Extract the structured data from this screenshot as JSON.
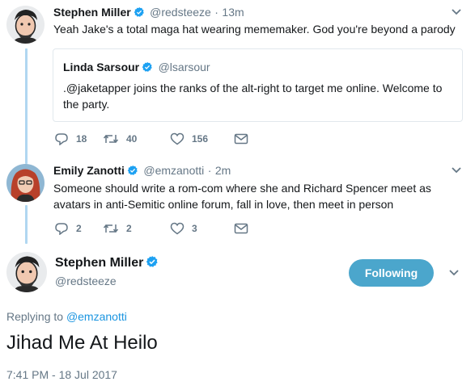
{
  "tweet1": {
    "name": "Stephen Miller",
    "handle": "@redsteeze",
    "separator": "·",
    "time": "13m",
    "text": "Yeah Jake's a total maga hat wearing mememaker. God you're beyond a parody",
    "quote": {
      "name": "Linda Sarsour",
      "handle": "@lsarsour",
      "text": ".@jaketapper joins the ranks of the alt-right to target me online. Welcome to the party."
    },
    "replies": "18",
    "retweets": "40",
    "likes": "156"
  },
  "tweet2": {
    "name": "Emily Zanotti",
    "handle": "@emzanotti",
    "separator": "·",
    "time": "2m",
    "text": "Someone should write a rom-com where she and Richard Spencer meet as avatars in anti-Semitic online forum, fall in love, then meet in person",
    "replies": "2",
    "retweets": "2",
    "likes": "3"
  },
  "main": {
    "name": "Stephen Miller",
    "handle": "@redsteeze",
    "follow_label": "Following",
    "replying_prefix": "Replying to",
    "replying_to": "@emzanotti",
    "text": "Jihad Me At Heilo",
    "timestamp": "7:41 PM - 18 Jul 2017"
  },
  "colors": {
    "verified": "#1da1f2",
    "link": "#1b95e0",
    "follow_button": "#4ba6cc",
    "thread_line": "#b0d7f1"
  },
  "icons": [
    "reply-icon",
    "retweet-icon",
    "like-icon",
    "direct-message-icon",
    "chevron-down-icon",
    "verified-badge-icon"
  ]
}
